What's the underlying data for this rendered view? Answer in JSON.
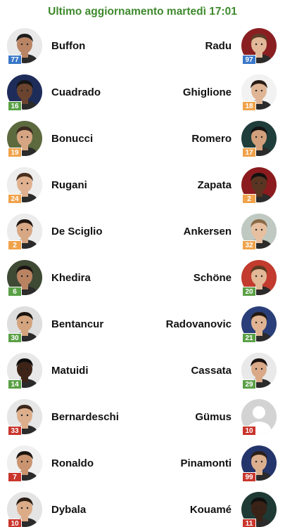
{
  "header": {
    "title": "Ultimo aggiornamento martedì 17:01"
  },
  "badge_colors": {
    "blue": "#3a78c8",
    "green": "#5aa046",
    "orange": "#f0a24a",
    "red": "#c9352c"
  },
  "matchups": [
    {
      "home": {
        "name": "Buffon",
        "badge": "77",
        "color": "blue",
        "skin": "#b98564",
        "hair": "#1d1d1d",
        "bg": "#e9e9e9"
      },
      "away": {
        "name": "Radu",
        "badge": "97",
        "color": "blue",
        "skin": "#e2b898",
        "hair": "#5b3e28",
        "bg": "#8a1f22"
      }
    },
    {
      "home": {
        "name": "Cuadrado",
        "badge": "16",
        "color": "green",
        "skin": "#6b4430",
        "hair": "#151515",
        "bg": "#1e2c5a"
      },
      "away": {
        "name": "Ghiglione",
        "badge": "18",
        "color": "orange",
        "skin": "#e0b595",
        "hair": "#2a1d15",
        "bg": "#f2f2f2"
      }
    },
    {
      "home": {
        "name": "Bonucci",
        "badge": "19",
        "color": "orange",
        "skin": "#d6a583",
        "hair": "#3a2a1f",
        "bg": "#5c6a3e"
      },
      "away": {
        "name": "Romero",
        "badge": "17",
        "color": "orange",
        "skin": "#d2a07c",
        "hair": "#141414",
        "bg": "#1f3d3a"
      }
    },
    {
      "home": {
        "name": "Rugani",
        "badge": "24",
        "color": "orange",
        "skin": "#e0b190",
        "hair": "#4a3020",
        "bg": "#eeeeee"
      },
      "away": {
        "name": "Zapata",
        "badge": "2",
        "color": "orange",
        "skin": "#5a3522",
        "hair": "#111111",
        "bg": "#8b1b1e"
      }
    },
    {
      "home": {
        "name": "De Sciglio",
        "badge": "2",
        "color": "orange",
        "skin": "#d8a884",
        "hair": "#20160f",
        "bg": "#ececec"
      },
      "away": {
        "name": "Ankersen",
        "badge": "32",
        "color": "orange",
        "skin": "#e6c0a0",
        "hair": "#8b6a46",
        "bg": "#bfc9c2"
      }
    },
    {
      "home": {
        "name": "Khedira",
        "badge": "6",
        "color": "green",
        "skin": "#b98362",
        "hair": "#1a1410",
        "bg": "#3f4a35"
      },
      "away": {
        "name": "Schöne",
        "badge": "20",
        "color": "green",
        "skin": "#e2b896",
        "hair": "#5a3b22",
        "bg": "#c23b2e"
      }
    },
    {
      "home": {
        "name": "Bentancur",
        "badge": "30",
        "color": "green",
        "skin": "#d3a47e",
        "hair": "#1b140e",
        "bg": "#dedede"
      },
      "away": {
        "name": "Radovanovic",
        "badge": "21",
        "color": "green",
        "skin": "#e0b492",
        "hair": "#251912",
        "bg": "#2a3f7a"
      }
    },
    {
      "home": {
        "name": "Matuidi",
        "badge": "14",
        "color": "green",
        "skin": "#3d2417",
        "hair": "#0e0e0e",
        "bg": "#e8e8e8"
      },
      "away": {
        "name": "Cassata",
        "badge": "29",
        "color": "green",
        "skin": "#d9a988",
        "hair": "#1c1410",
        "bg": "#e9e9e9"
      }
    },
    {
      "home": {
        "name": "Bernardeschi",
        "badge": "33",
        "color": "red",
        "skin": "#dcae8c",
        "hair": "#3b281b",
        "bg": "#e6e6e6"
      },
      "away": {
        "name": "Gümus",
        "badge": "10",
        "color": "red",
        "placeholder": true
      }
    },
    {
      "home": {
        "name": "Ronaldo",
        "badge": "7",
        "color": "red",
        "skin": "#c9946f",
        "hair": "#1a130e",
        "bg": "#f0f0f0"
      },
      "away": {
        "name": "Pinamonti",
        "badge": "99",
        "color": "red",
        "skin": "#dcb08e",
        "hair": "#2c2018",
        "bg": "#24356b"
      }
    },
    {
      "home": {
        "name": "Dybala",
        "badge": "10",
        "color": "red",
        "skin": "#dcac88",
        "hair": "#2a1d14",
        "bg": "#e4e4e4"
      },
      "away": {
        "name": "Kouamé",
        "badge": "11",
        "color": "red",
        "skin": "#3a2216",
        "hair": "#0f0f0f",
        "bg": "#1f3a34"
      }
    }
  ]
}
